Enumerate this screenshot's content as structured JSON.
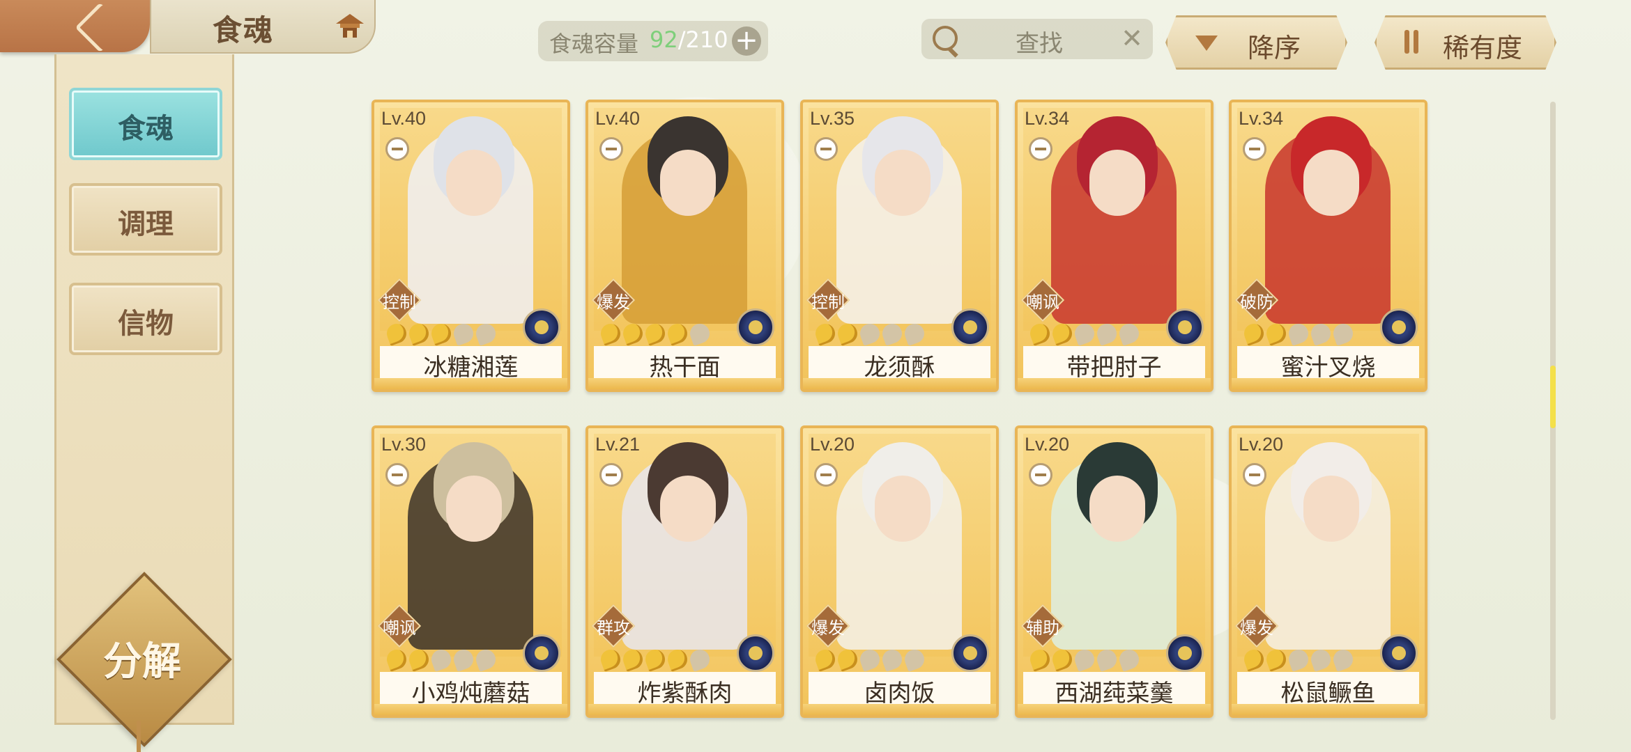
{
  "header": {
    "title": "食魂",
    "capacity": {
      "label": "食魂容量",
      "current": "92",
      "separator": "/",
      "total": "210",
      "add": "+"
    },
    "search": {
      "text": "查找",
      "clear": "✕"
    },
    "sort_order": "降序",
    "sort_by": "稀有度"
  },
  "sidebar": {
    "items": [
      {
        "label": "食魂",
        "active": true
      },
      {
        "label": "调理",
        "active": false
      },
      {
        "label": "信物",
        "active": false
      }
    ],
    "decompose": "分解"
  },
  "cards": [
    {
      "level": "Lv.40",
      "tag": "控制",
      "name": "冰糖湘莲",
      "stars_on": 3,
      "hair": "#dfe2e8",
      "robe": "#f0f0f4"
    },
    {
      "level": "Lv.40",
      "tag": "爆发",
      "name": "热干面",
      "stars_on": 4,
      "hair": "#3a3430",
      "robe": "#d59d36"
    },
    {
      "level": "Lv.35",
      "tag": "控制",
      "name": "龙须酥",
      "stars_on": 2,
      "hair": "#e6e6ea",
      "robe": "#f4f2ee"
    },
    {
      "level": "Lv.34",
      "tag": "嘲讽",
      "name": "带把肘子",
      "stars_on": 2,
      "hair": "#b52432",
      "robe": "#c8362f"
    },
    {
      "level": "Lv.34",
      "tag": "破防",
      "name": "蜜汁叉烧",
      "stars_on": 2,
      "hair": "#c8282a",
      "robe": "#c8352d"
    },
    {
      "level": "Lv.30",
      "tag": "嘲讽",
      "name": "小鸡炖蘑菇",
      "stars_on": 2,
      "hair": "#cdbf9e",
      "robe": "#3b3128"
    },
    {
      "level": "Lv.21",
      "tag": "群攻",
      "name": "炸紫酥肉",
      "stars_on": 4,
      "hair": "#4b3a32",
      "robe": "#e8e6ef"
    },
    {
      "level": "Lv.20",
      "tag": "爆发",
      "name": "卤肉饭",
      "stars_on": 2,
      "hair": "#f0eee9",
      "robe": "#f3f1ea"
    },
    {
      "level": "Lv.20",
      "tag": "辅助",
      "name": "西湖莼菜羹",
      "stars_on": 2,
      "hair": "#2a3a36",
      "robe": "#ddeee3"
    },
    {
      "level": "Lv.20",
      "tag": "爆发",
      "name": "松鼠鳜鱼",
      "stars_on": 2,
      "hair": "#f2ede8",
      "robe": "#f5f0e6"
    }
  ]
}
